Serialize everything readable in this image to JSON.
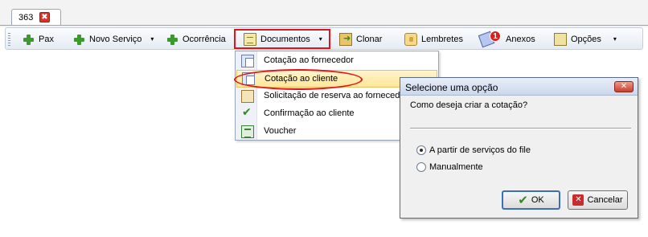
{
  "tab": {
    "label": "363",
    "close_glyph": "✖"
  },
  "toolbar": {
    "items": [
      {
        "label": "Pax",
        "hotkey": "P"
      },
      {
        "label": "Novo Serviço",
        "hotkey": "N"
      },
      {
        "label": "Ocorrência",
        "hotkey": "O"
      },
      {
        "label": "Documentos",
        "hotkey": "D"
      },
      {
        "label": "Clonar",
        "hotkey": "C"
      },
      {
        "label": "Lembretes",
        "hotkey": "L"
      },
      {
        "label": "Anexos",
        "badge": "1"
      },
      {
        "label": "Opções",
        "hotkey": "O"
      }
    ],
    "dropdown_glyph": "▾"
  },
  "menu": {
    "items": [
      {
        "label": "Cotação ao fornecedor"
      },
      {
        "label": "Cotação ao cliente",
        "highlighted": true
      },
      {
        "label": "Solicitação de reserva ao fornecedor"
      },
      {
        "label": "Confirmação ao cliente"
      },
      {
        "label": "Voucher"
      }
    ]
  },
  "dialog": {
    "title": "Selecione uma opção",
    "question": "Como deseja criar a cotação?",
    "options": [
      {
        "label": "A partir de serviços do file",
        "selected": true
      },
      {
        "label": "Manualmente",
        "selected": false
      }
    ],
    "ok_label": "OK",
    "cancel_label": "Cancelar"
  },
  "colors": {
    "annotation_red": "#e1141c",
    "accent_green": "#3a9a2a",
    "title_bar": "#cbd8ec"
  }
}
